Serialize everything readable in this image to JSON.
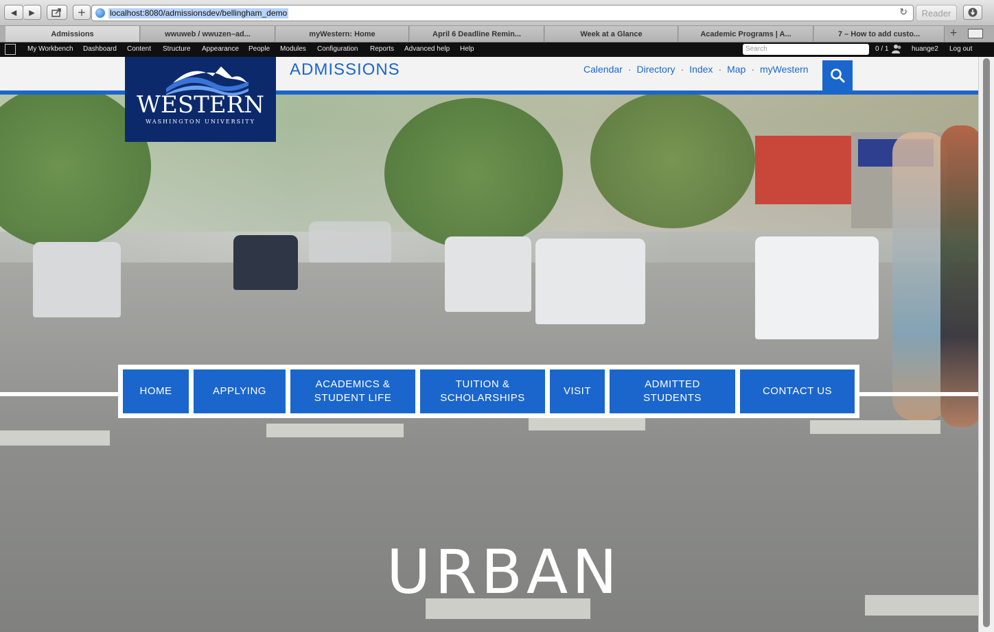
{
  "browser": {
    "url": "localhost:8080/admissionsdev/bellingham_demo",
    "reader_label": "Reader",
    "tabs": [
      {
        "label": "Admissions"
      },
      {
        "label": "wwuweb / wwuzen–ad..."
      },
      {
        "label": "myWestern: Home"
      },
      {
        "label": "April 6 Deadline Remin..."
      },
      {
        "label": "Week at a Glance"
      },
      {
        "label": "Academic Programs | A..."
      },
      {
        "label": "7 – How to add custo..."
      }
    ]
  },
  "admin_bar": {
    "items": [
      "My Workbench",
      "Dashboard",
      "Content",
      "Structure",
      "Appearance",
      "People",
      "Modules",
      "Configuration",
      "Reports",
      "Advanced help",
      "Help"
    ],
    "search_placeholder": "Search",
    "user_count": "0 / 1",
    "username": "huange2",
    "logout": "Log out"
  },
  "site": {
    "logo_word": "WESTERN",
    "logo_sub": "WASHINGTON UNIVERSITY",
    "title": "ADMISSIONS",
    "util_links": [
      "Calendar",
      "Directory",
      "Index",
      "Map",
      "myWestern"
    ],
    "menu": [
      {
        "line1": "HOME",
        "line2": ""
      },
      {
        "line1": "APPLYING",
        "line2": ""
      },
      {
        "line1": "ACADEMICS &",
        "line2": "STUDENT LIFE"
      },
      {
        "line1": "TUITION &",
        "line2": "SCHOLARSHIPS"
      },
      {
        "line1": "VISIT",
        "line2": ""
      },
      {
        "line1": "ADMITTED",
        "line2": "STUDENTS"
      },
      {
        "line1": "CONTACT US",
        "line2": ""
      }
    ],
    "hero_word": "URBAN"
  },
  "colors": {
    "brand_blue": "#1b66cc",
    "logo_navy": "#0c2a6b",
    "admin_bar": "#101010"
  },
  "icons": [
    "back-arrow-icon",
    "forward-arrow-icon",
    "share-icon",
    "add-bookmark-icon",
    "globe-icon",
    "reload-icon",
    "download-icon",
    "new-tab-icon",
    "tab-list-icon",
    "search-icon",
    "user-icon"
  ]
}
